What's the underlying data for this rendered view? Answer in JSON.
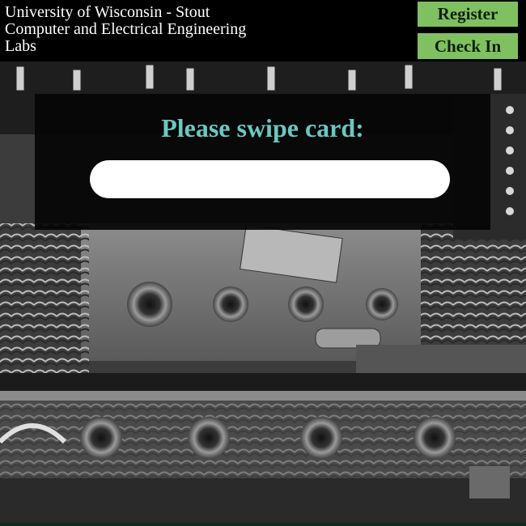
{
  "header": {
    "title_lines": [
      "University of Wisconsin - Stout",
      "Computer and Electrical Engineering",
      "Labs"
    ],
    "register_label": "Register",
    "checkin_label": "Check In"
  },
  "main": {
    "prompt": "Please swipe card:",
    "swipe_value": "",
    "swipe_placeholder": ""
  },
  "colors": {
    "header_bg": "#000000",
    "button_bg": "#7fc160",
    "prompt_text": "#6cc7c0",
    "panel_bg": "#050505"
  },
  "background": {
    "description_icon": "vacuum-tube-circuit-photo"
  }
}
